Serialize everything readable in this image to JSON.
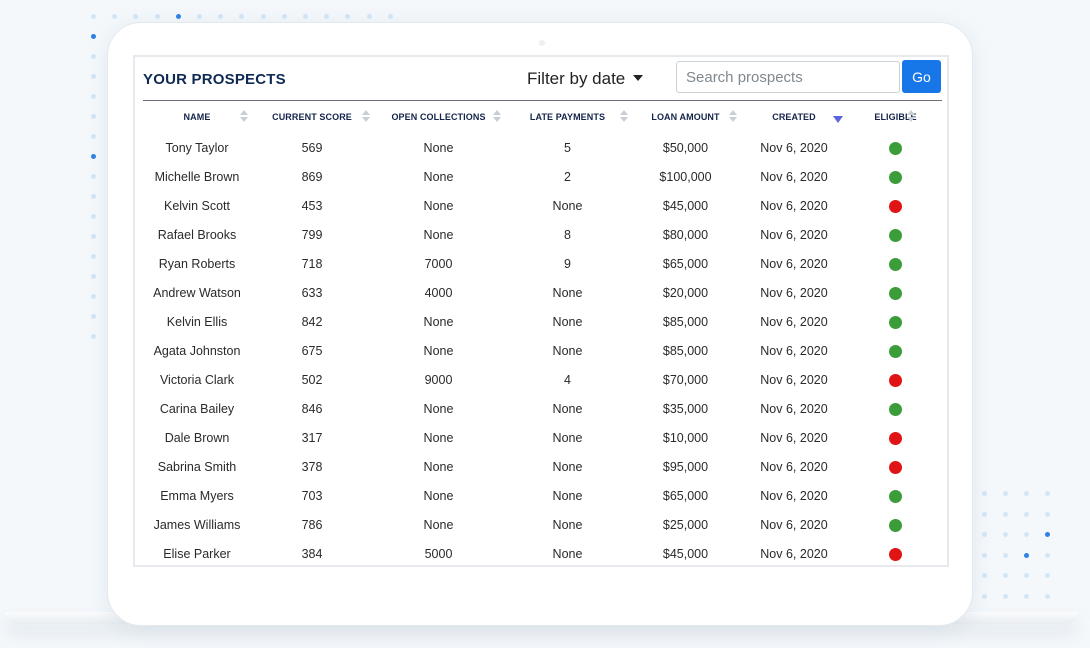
{
  "panel": {
    "title": "YOUR PROSPECTS",
    "filter_label": "Filter by date",
    "search_placeholder": "Search prospects",
    "go_label": "Go"
  },
  "table": {
    "headers": [
      "NAME",
      "CURRENT SCORE",
      "OPEN COLLECTIONS",
      "LATE PAYMENTS",
      "LOAN AMOUNT",
      "CREATED",
      "ELIGIBLE"
    ],
    "sorted_column": "CREATED",
    "rows": [
      {
        "name": "Tony Taylor",
        "score": "569",
        "collections": "None",
        "late": "5",
        "loan": "$50,000",
        "created": "Nov 6, 2020",
        "eligible": true
      },
      {
        "name": "Michelle Brown",
        "score": "869",
        "collections": "None",
        "late": "2",
        "loan": "$100,000",
        "created": "Nov 6, 2020",
        "eligible": true
      },
      {
        "name": "Kelvin Scott",
        "score": "453",
        "collections": "None",
        "late": "None",
        "loan": "$45,000",
        "created": "Nov 6, 2020",
        "eligible": false
      },
      {
        "name": "Rafael Brooks",
        "score": "799",
        "collections": "None",
        "late": "8",
        "loan": "$80,000",
        "created": "Nov 6, 2020",
        "eligible": true
      },
      {
        "name": "Ryan Roberts",
        "score": "718",
        "collections": "7000",
        "late": "9",
        "loan": "$65,000",
        "created": "Nov 6, 2020",
        "eligible": true
      },
      {
        "name": "Andrew Watson",
        "score": "633",
        "collections": "4000",
        "late": "None",
        "loan": "$20,000",
        "created": "Nov 6, 2020",
        "eligible": true
      },
      {
        "name": "Kelvin Ellis",
        "score": "842",
        "collections": "None",
        "late": "None",
        "loan": "$85,000",
        "created": "Nov 6, 2020",
        "eligible": true
      },
      {
        "name": "Agata Johnston",
        "score": "675",
        "collections": "None",
        "late": "None",
        "loan": "$85,000",
        "created": "Nov 6, 2020",
        "eligible": true
      },
      {
        "name": "Victoria Clark",
        "score": "502",
        "collections": "9000",
        "late": "4",
        "loan": "$70,000",
        "created": "Nov 6, 2020",
        "eligible": false
      },
      {
        "name": "Carina Bailey",
        "score": "846",
        "collections": "None",
        "late": "None",
        "loan": "$35,000",
        "created": "Nov 6, 2020",
        "eligible": true
      },
      {
        "name": "Dale Brown",
        "score": "317",
        "collections": "None",
        "late": "None",
        "loan": "$10,000",
        "created": "Nov 6, 2020",
        "eligible": false
      },
      {
        "name": "Sabrina Smith",
        "score": "378",
        "collections": "None",
        "late": "None",
        "loan": "$95,000",
        "created": "Nov 6, 2020",
        "eligible": false
      },
      {
        "name": "Emma Myers",
        "score": "703",
        "collections": "None",
        "late": "None",
        "loan": "$65,000",
        "created": "Nov 6, 2020",
        "eligible": true
      },
      {
        "name": "James Williams",
        "score": "786",
        "collections": "None",
        "late": "None",
        "loan": "$25,000",
        "created": "Nov 6, 2020",
        "eligible": true
      },
      {
        "name": "Elise Parker",
        "score": "384",
        "collections": "5000",
        "late": "None",
        "loan": "$45,000",
        "created": "Nov 6, 2020",
        "eligible": false
      }
    ]
  },
  "colors": {
    "eligible_yes": "#3a9d3a",
    "eligible_no": "#e01414",
    "accent": "#1877e8",
    "title": "#0f2a54"
  }
}
